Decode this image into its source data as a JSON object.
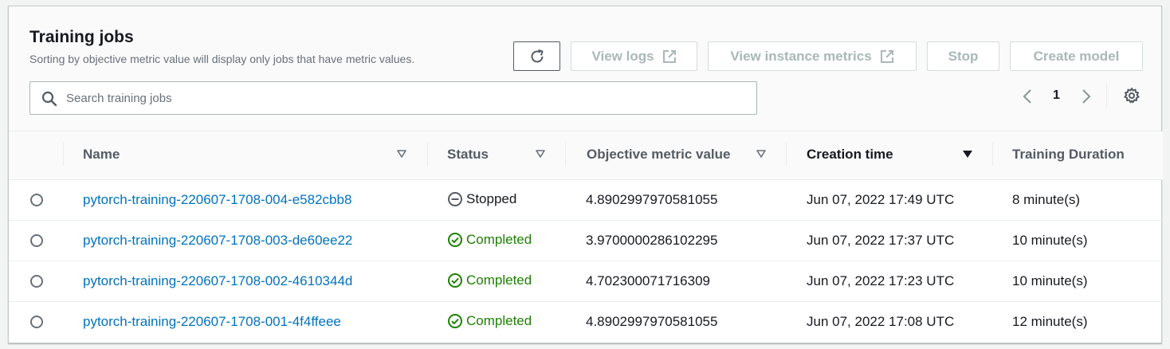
{
  "header": {
    "title": "Training jobs",
    "subtitle": "Sorting by objective metric value will display only jobs that have metric values.",
    "buttons": {
      "view_logs": "View logs",
      "view_instance_metrics": "View instance metrics",
      "stop": "Stop",
      "create_model": "Create model"
    }
  },
  "search": {
    "placeholder": "Search training jobs",
    "value": ""
  },
  "pagination": {
    "current_page": "1"
  },
  "table": {
    "columns": [
      "Name",
      "Status",
      "Objective metric value",
      "Creation time",
      "Training Duration"
    ],
    "sorted_column": "Creation time",
    "rows": [
      {
        "name": "pytorch-training-220607-1708-004-e582cbb8",
        "status": "Stopped",
        "status_type": "stopped",
        "metric": "4.8902997970581055",
        "created": "Jun 07, 2022 17:49 UTC",
        "duration": "8 minute(s)"
      },
      {
        "name": "pytorch-training-220607-1708-003-de60ee22",
        "status": "Completed",
        "status_type": "completed",
        "metric": "3.9700000286102295",
        "created": "Jun 07, 2022 17:37 UTC",
        "duration": "10 minute(s)"
      },
      {
        "name": "pytorch-training-220607-1708-002-4610344d",
        "status": "Completed",
        "status_type": "completed",
        "metric": "4.702300071716309",
        "created": "Jun 07, 2022 17:23 UTC",
        "duration": "10 minute(s)"
      },
      {
        "name": "pytorch-training-220607-1708-001-4f4ffeee",
        "status": "Completed",
        "status_type": "completed",
        "metric": "4.8902997970581055",
        "created": "Jun 07, 2022 17:08 UTC",
        "duration": "12 minute(s)"
      }
    ]
  },
  "colors": {
    "link": "#0073bb",
    "completed": "#1d8102",
    "disabled_text": "#aab7b8",
    "text": "#16191f"
  },
  "icons": {
    "refresh": "refresh-icon",
    "external": "external-link-icon",
    "search": "search-icon",
    "prev": "chevron-left-icon",
    "next": "chevron-right-icon",
    "settings": "gear-icon",
    "sort_inactive": "caret-down-outline-icon",
    "sort_active": "caret-down-filled-icon",
    "stopped": "stopped-icon",
    "completed": "check-circle-icon"
  }
}
